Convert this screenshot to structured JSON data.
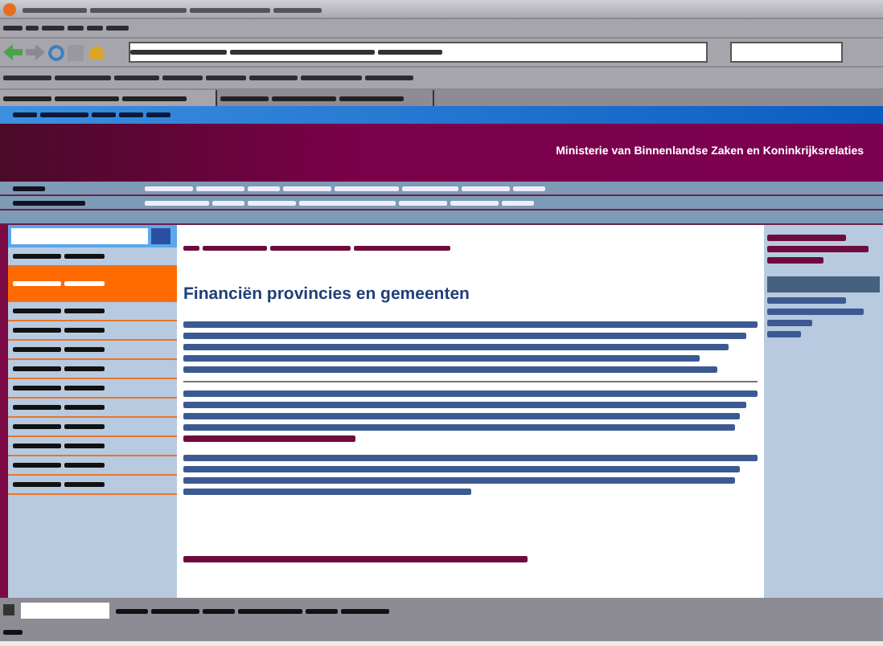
{
  "site": {
    "ministry": "Ministerie van Binnenlandse Zaken en Koninkrijksrelaties"
  },
  "sidebar": {
    "items": [
      {
        "selected": false
      },
      {
        "selected": true
      },
      {
        "selected": false
      },
      {
        "selected": false
      },
      {
        "selected": false
      },
      {
        "selected": false
      },
      {
        "selected": false
      },
      {
        "selected": false
      },
      {
        "selected": false
      },
      {
        "selected": false
      },
      {
        "selected": false
      },
      {
        "selected": false
      }
    ]
  },
  "article": {
    "title": "Financiën provincies en gemeenten"
  }
}
